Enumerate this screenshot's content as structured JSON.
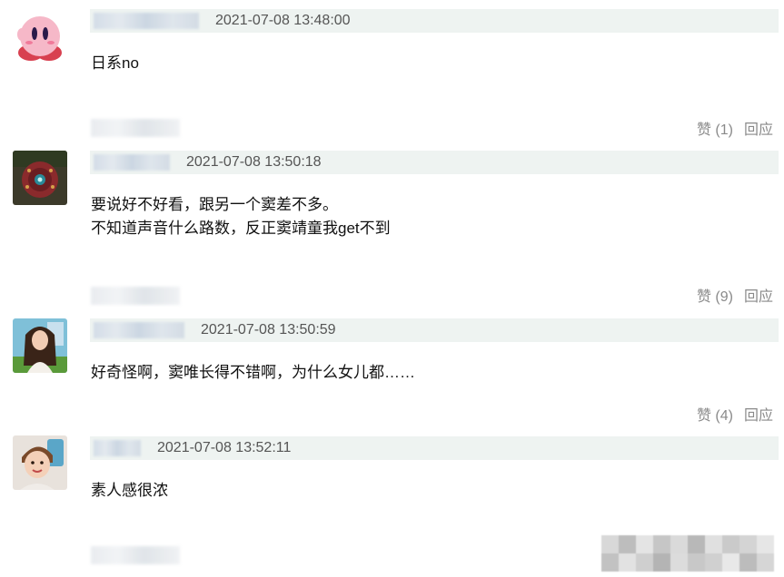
{
  "comments": [
    {
      "timestamp": "2021-07-08 13:48:00",
      "lines": [
        "日系no"
      ],
      "like_label": "赞 (1)",
      "reply_label": "回应",
      "avatar_icon": "kirby-avatar"
    },
    {
      "timestamp": "2021-07-08 13:50:18",
      "lines": [
        "要说好不好看，跟另一个窦差不多。",
        "不知道声音什么路数，反正窦靖童我get不到"
      ],
      "like_label": "赞 (9)",
      "reply_label": "回应",
      "avatar_icon": "red-orb-avatar"
    },
    {
      "timestamp": "2021-07-08 13:50:59",
      "lines": [
        "好奇怪啊，窦唯长得不错啊，为什么女儿都……"
      ],
      "like_label": "赞 (4)",
      "reply_label": "回应",
      "avatar_icon": "woman-photo-avatar"
    },
    {
      "timestamp": "2021-07-08 13:52:11",
      "lines": [
        "素人感很浓"
      ],
      "like_label": "",
      "reply_label": "",
      "avatar_icon": "child-photo-avatar"
    }
  ]
}
